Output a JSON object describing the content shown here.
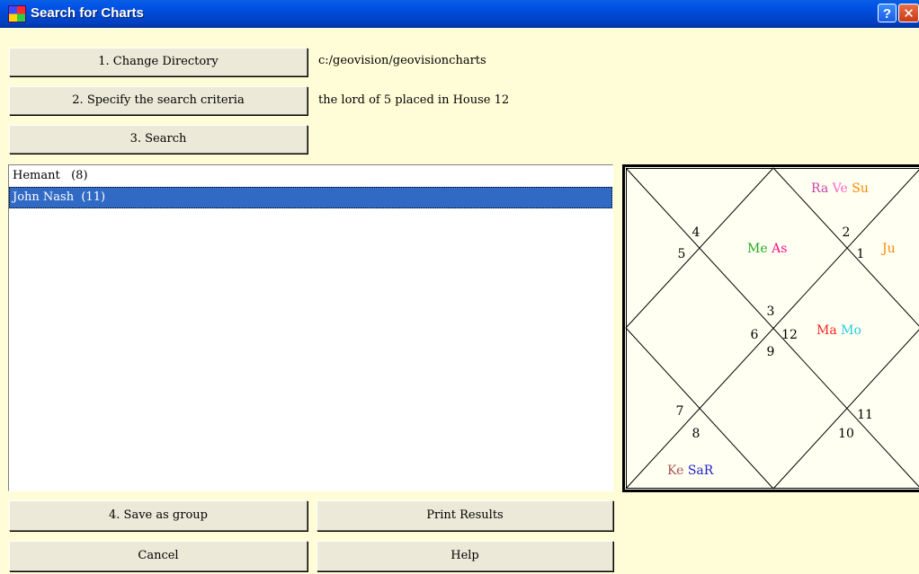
{
  "window": {
    "title": "Search for Charts",
    "help_glyph": "?",
    "close_glyph": "✕"
  },
  "controls": {
    "change_directory": {
      "label": "1. Change Directory",
      "value": "c:/geovision/geovisioncharts"
    },
    "search_criteria": {
      "label": "2. Specify the search criteria",
      "value": "the lord of 5 placed in House 12"
    },
    "search": {
      "label": "3. Search"
    }
  },
  "results": [
    {
      "label": "Hemant   (8)",
      "selected": false
    },
    {
      "label": "John Nash  (11)",
      "selected": true
    }
  ],
  "chart": {
    "house_numbers": [
      "1",
      "2",
      "3",
      "4",
      "5",
      "6",
      "7",
      "8",
      "9",
      "10",
      "11",
      "12"
    ],
    "planets": {
      "ra": {
        "text": "Ra",
        "color": "#cc44aa"
      },
      "ve": {
        "text": "Ve",
        "color": "#ff66cc"
      },
      "su": {
        "text": "Su",
        "color": "#ff8800"
      },
      "ju": {
        "text": "Ju",
        "color": "#ff8800"
      },
      "me": {
        "text": "Me",
        "color": "#22aa22"
      },
      "as": {
        "text": "As",
        "color": "#ff1188"
      },
      "ma": {
        "text": "Ma",
        "color": "#ff2222"
      },
      "mo": {
        "text": "Mo",
        "color": "#22ccdd"
      },
      "ke": {
        "text": "Ke",
        "color": "#aa5555"
      },
      "sar": {
        "text": "SaR",
        "color": "#2222cc"
      }
    }
  },
  "footer": {
    "save_group": "4. Save as group",
    "print_results": "Print Results",
    "cancel": "Cancel",
    "help": "Help"
  }
}
